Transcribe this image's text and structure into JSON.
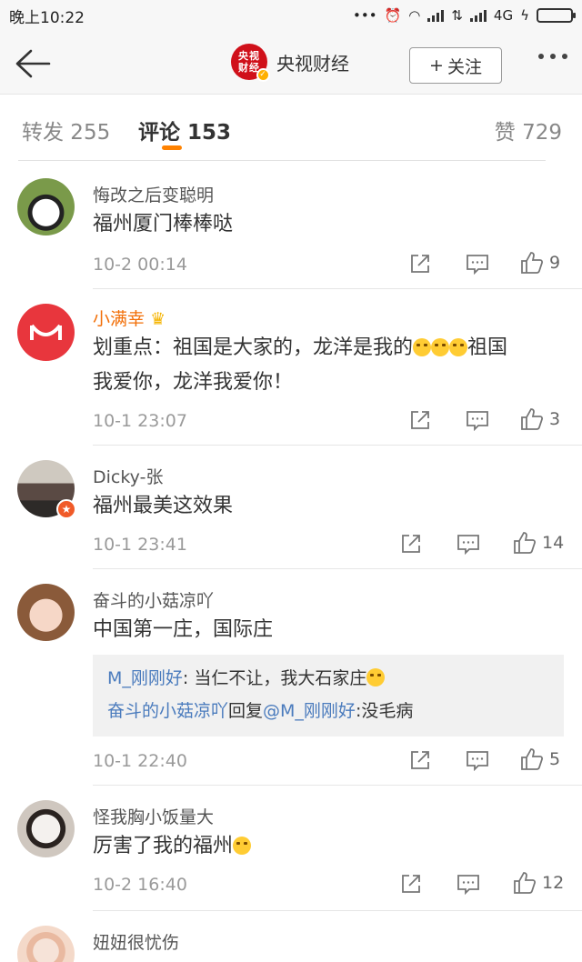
{
  "status_bar": {
    "time": "晚上10:22",
    "network": "4G"
  },
  "nav": {
    "title": "央视财经",
    "logo_text_1": "央视",
    "logo_text_2": "财经",
    "follow_label": "关注",
    "follow_plus": "+"
  },
  "tabs": [
    {
      "label": "转发 255"
    },
    {
      "label": "评论 153"
    },
    {
      "label": "赞 729"
    }
  ],
  "comments": [
    {
      "name": "悔改之后变聪明",
      "text": "福州厦门棒棒哒",
      "time": "10-2 00:14",
      "likes": "9"
    },
    {
      "name": "小满幸",
      "text_part1": "划重点：祖国是大家的，龙洋是我的",
      "text_part2": "祖国",
      "text_line2": "我爱你，龙洋我爱你！",
      "time": "10-1 23:07",
      "likes": "3"
    },
    {
      "name": "Dicky-张",
      "text": "福州最美这效果",
      "time": "10-1 23:41",
      "likes": "14"
    },
    {
      "name": "奋斗的小菇凉吖",
      "text": "中国第一庄，国际庄",
      "time": "10-1 22:40",
      "likes": "5",
      "replies": [
        {
          "user": "M_刚刚好",
          "text": ": 当仁不让，我大石家庄"
        },
        {
          "user": "奋斗的小菇凉吖",
          "mid": "回复",
          "target": "@M_刚刚好",
          "text": ":没毛病"
        }
      ]
    },
    {
      "name": "怪我胸小饭量大",
      "text": "厉害了我的福州",
      "time": "10-2 16:40",
      "likes": "12"
    },
    {
      "name": "妞妞很忧伤",
      "text": "",
      "time": "",
      "likes": ""
    }
  ]
}
